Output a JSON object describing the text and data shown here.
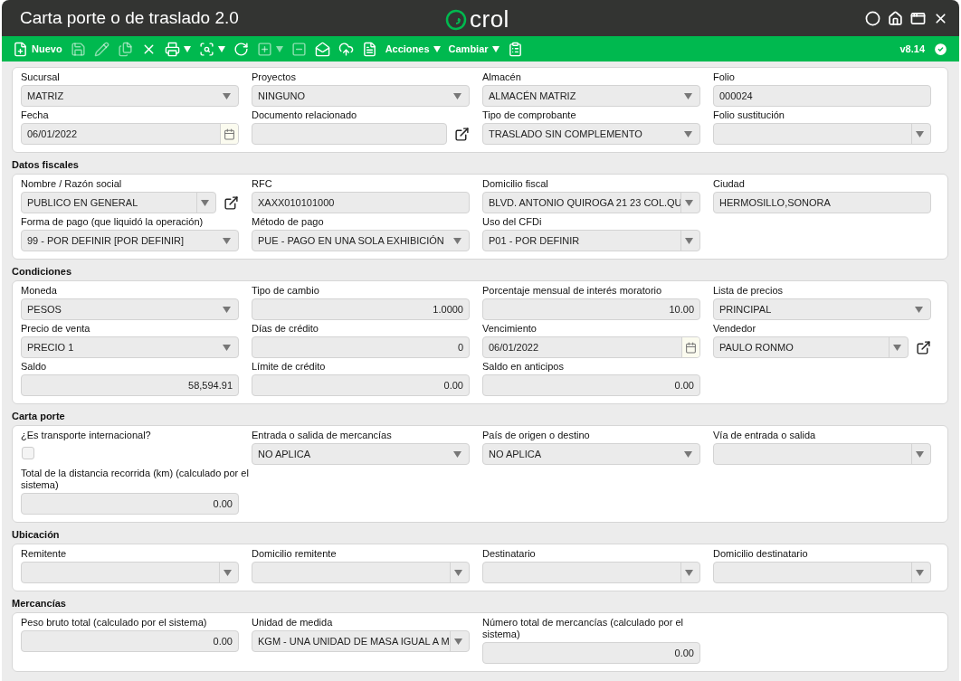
{
  "window": {
    "title": "Carta porte o de traslado 2.0",
    "logo": "crol",
    "controls": [
      {
        "kind": "refresh"
      },
      {
        "kind": "home"
      },
      {
        "kind": "restore"
      },
      {
        "kind": "close"
      }
    ]
  },
  "toolbar": {
    "items": [
      {
        "kind": "new",
        "label": "Nuevo",
        "disabled": false,
        "menu": false
      },
      {
        "kind": "save",
        "disabled": true,
        "menu": false
      },
      {
        "kind": "edit",
        "disabled": true,
        "menu": false
      },
      {
        "kind": "copy",
        "disabled": true,
        "menu": false
      },
      {
        "kind": "cancel",
        "disabled": false,
        "menu": false
      },
      {
        "kind": "print",
        "disabled": false,
        "menu": true
      },
      {
        "kind": "preview",
        "disabled": false,
        "menu": true
      },
      {
        "kind": "reload",
        "disabled": false,
        "menu": false
      },
      {
        "kind": "add",
        "disabled": true,
        "menu": true
      },
      {
        "kind": "remove",
        "disabled": true,
        "menu": false
      },
      {
        "kind": "mail",
        "disabled": false,
        "menu": false
      },
      {
        "kind": "upload",
        "disabled": false,
        "menu": false
      },
      {
        "kind": "document",
        "disabled": false,
        "menu": false
      },
      {
        "kind": "text",
        "label": "Acciones",
        "disabled": false,
        "menu": true
      },
      {
        "kind": "text",
        "label": "Cambiar",
        "disabled": false,
        "menu": true
      },
      {
        "kind": "clipboard",
        "disabled": false,
        "menu": false
      }
    ],
    "version": "v8.14"
  },
  "sections": [
    {
      "rows": [
        [
          {
            "label": "Sucursal",
            "value": "MATRIZ",
            "kind": "select"
          },
          {
            "label": "Proyectos",
            "value": "NINGUNO",
            "kind": "select"
          },
          {
            "label": "Almacén",
            "value": "ALMACÉN MATRIZ",
            "kind": "select"
          },
          {
            "label": "Folio",
            "value": "000024",
            "kind": "text"
          }
        ],
        [
          {
            "label": "Fecha",
            "value": "06/01/2022",
            "kind": "date"
          },
          {
            "label": "Documento relacionado",
            "kind": "text",
            "linked": true
          },
          {
            "label": "Tipo de comprobante",
            "value": "TRASLADO SIN COMPLEMENTO",
            "kind": "select"
          },
          {
            "label": "Folio sustitución",
            "kind": "combo"
          }
        ]
      ]
    },
    {
      "title": "Datos fiscales",
      "rows": [
        [
          {
            "label": "Nombre / Razón social",
            "value": "PUBLICO EN GENERAL",
            "kind": "combo",
            "linked": true
          },
          {
            "label": "RFC",
            "value": "XAXX010101000",
            "kind": "text"
          },
          {
            "label": "Domicilio fiscal",
            "value": "BLVD. ANTONIO QUIROGA 21 23 COL.QU",
            "kind": "combo"
          },
          {
            "label": "Ciudad",
            "value": "HERMOSILLO,SONORA",
            "kind": "text"
          }
        ],
        [
          {
            "label": "Forma de pago (que liquidó la operación)",
            "value": "99 - POR DEFINIR [POR DEFINIR]",
            "kind": "select"
          },
          {
            "label": "Método de pago",
            "value": "PUE - PAGO EN UNA SOLA EXHIBICIÓN",
            "kind": "select"
          },
          {
            "label": "Uso del CFDi",
            "value": "P01 - POR DEFINIR",
            "kind": "combo"
          }
        ]
      ]
    },
    {
      "title": "Condiciones",
      "rows": [
        [
          {
            "label": "Moneda",
            "value": "PESOS",
            "kind": "select"
          },
          {
            "label": "Tipo de cambio",
            "value": "1.0000",
            "kind": "number"
          },
          {
            "label": "Porcentaje mensual de interés moratorio",
            "value": "10.00",
            "kind": "number"
          },
          {
            "label": "Lista de precios",
            "value": "PRINCIPAL",
            "kind": "select"
          }
        ],
        [
          {
            "label": "Precio de venta",
            "value": "PRECIO 1",
            "kind": "select"
          },
          {
            "label": "Días de crédito",
            "value": "0",
            "kind": "number"
          },
          {
            "label": "Vencimiento",
            "value": "06/01/2022",
            "kind": "date"
          },
          {
            "label": "Vendedor",
            "value": "PAULO RONMO",
            "kind": "combo",
            "linked": true
          }
        ],
        [
          {
            "label": "Saldo",
            "value": "58,594.91",
            "kind": "number"
          },
          {
            "label": "Límite de crédito",
            "value": "0.00",
            "kind": "number"
          },
          {
            "label": "Saldo en anticipos",
            "value": "0.00",
            "kind": "number"
          }
        ]
      ]
    },
    {
      "title": "Carta porte",
      "rows": [
        [
          {
            "label": "¿Es transporte internacional?",
            "kind": "checkbox",
            "checked": false
          },
          {
            "label": "Entrada o salida de mercancías",
            "value": "NO APLICA",
            "kind": "select"
          },
          {
            "label": "País de origen o destino",
            "value": "NO APLICA",
            "kind": "select"
          },
          {
            "label": "Vía de entrada o salida",
            "kind": "combo"
          }
        ],
        [
          {
            "label": "Total de la distancia recorrida (km) (calculado por el sistema)",
            "value": "0.00",
            "kind": "number"
          }
        ]
      ]
    },
    {
      "title": "Ubicación",
      "rows": [
        [
          {
            "label": "Remitente",
            "kind": "combo"
          },
          {
            "label": "Domicilio remitente",
            "kind": "combo"
          },
          {
            "label": "Destinatario",
            "kind": "combo"
          },
          {
            "label": "Domicilio destinatario",
            "kind": "combo"
          }
        ]
      ]
    },
    {
      "title": "Mercancías",
      "rows": [
        [
          {
            "label": "Peso bruto total (calculado por el sistema)",
            "value": "0.00",
            "kind": "number"
          },
          {
            "label": "Unidad de medida",
            "value": "KGM - UNA UNIDAD DE MASA IGUAL A M",
            "kind": "combo"
          },
          {
            "label": "Número total de mercancías (calculado por el sistema)",
            "value": "0.00",
            "kind": "number"
          }
        ]
      ]
    }
  ]
}
